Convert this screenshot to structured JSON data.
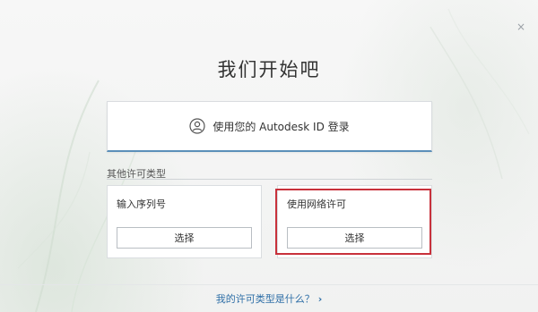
{
  "dialog": {
    "title": "我们开始吧",
    "close_icon": "close-icon",
    "close_glyph": "×"
  },
  "signin": {
    "icon": "user-icon",
    "label": "使用您的 Autodesk ID 登录"
  },
  "other_license": {
    "heading": "其他许可类型",
    "serial": {
      "title": "输入序列号",
      "button": "选择"
    },
    "network": {
      "title": "使用网络许可",
      "button": "选择"
    }
  },
  "help": {
    "link": "我的许可类型是什么？",
    "chevron": "›"
  },
  "colors": {
    "accent": "#5b8fb9",
    "link": "#2f6fa7",
    "highlight": "#c8313b"
  }
}
